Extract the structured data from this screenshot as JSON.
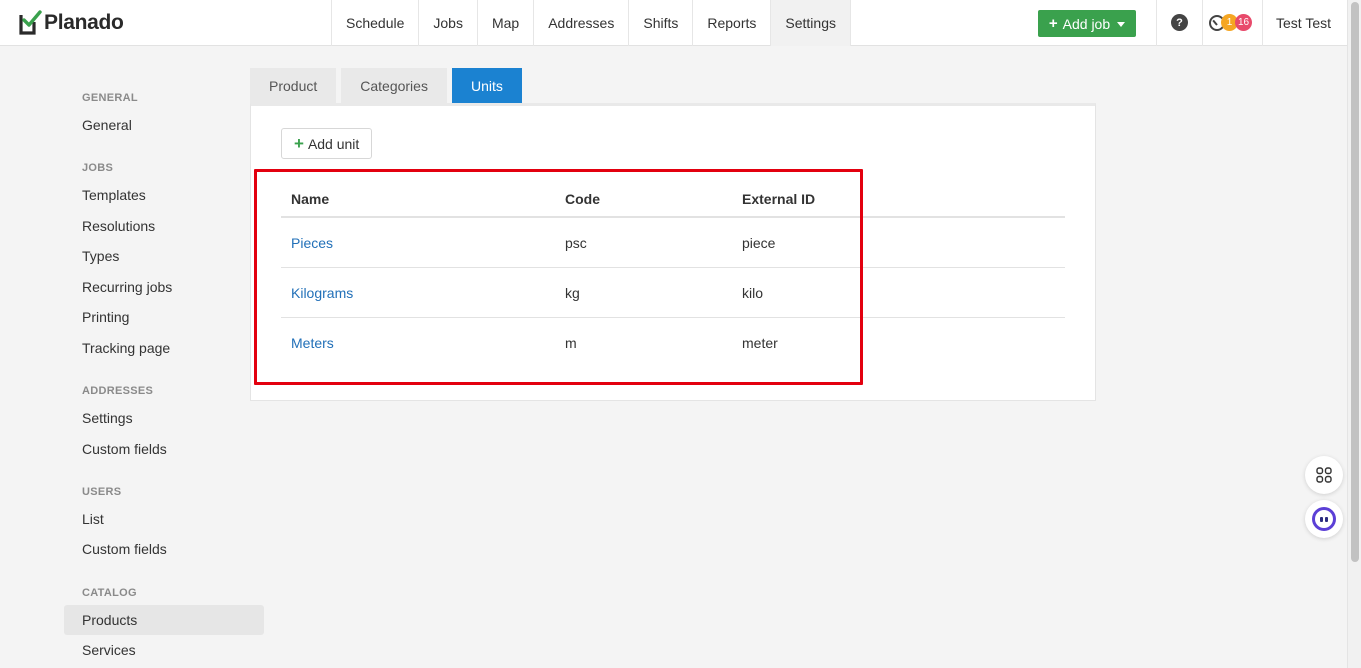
{
  "app": {
    "name": "Planado",
    "user": "Test Test"
  },
  "nav": [
    "Schedule",
    "Jobs",
    "Map",
    "Addresses",
    "Shifts",
    "Reports",
    "Settings"
  ],
  "nav_active": "Settings",
  "add_job": "Add job",
  "notifications": {
    "warning_count": "1",
    "alert_count": "16"
  },
  "help_icon": "?",
  "sidebar": {
    "general_heading": "GENERAL",
    "general_items": [
      "General"
    ],
    "jobs_heading": "JOBS",
    "jobs_items": [
      "Templates",
      "Resolutions",
      "Types",
      "Recurring jobs",
      "Printing",
      "Tracking page"
    ],
    "addresses_heading": "ADDRESSES",
    "addresses_items": [
      "Settings",
      "Custom fields"
    ],
    "users_heading": "USERS",
    "users_items": [
      "List",
      "Custom fields"
    ],
    "catalog_heading": "CATALOG",
    "catalog_items": [
      "Products",
      "Services"
    ],
    "active": "Products"
  },
  "tabs": [
    "Product",
    "Categories",
    "Units"
  ],
  "tab_active": "Units",
  "add_unit": "Add unit",
  "table": {
    "headers": [
      "Name",
      "Code",
      "External ID"
    ],
    "rows": [
      {
        "name": "Pieces",
        "code": "psc",
        "external_id": "piece"
      },
      {
        "name": "Kilograms",
        "code": "kg",
        "external_id": "kilo"
      },
      {
        "name": "Meters",
        "code": "m",
        "external_id": "meter"
      }
    ]
  },
  "colors": {
    "primary": "#1b82d1",
    "success": "#3aa14d",
    "link": "#2270b8",
    "highlight": "#e3000f"
  },
  "icons": [
    "logo-check-icon",
    "plus-icon",
    "caret-down-icon",
    "help-icon",
    "clock-icon",
    "apps-grid-icon",
    "chatbot-icon"
  ]
}
